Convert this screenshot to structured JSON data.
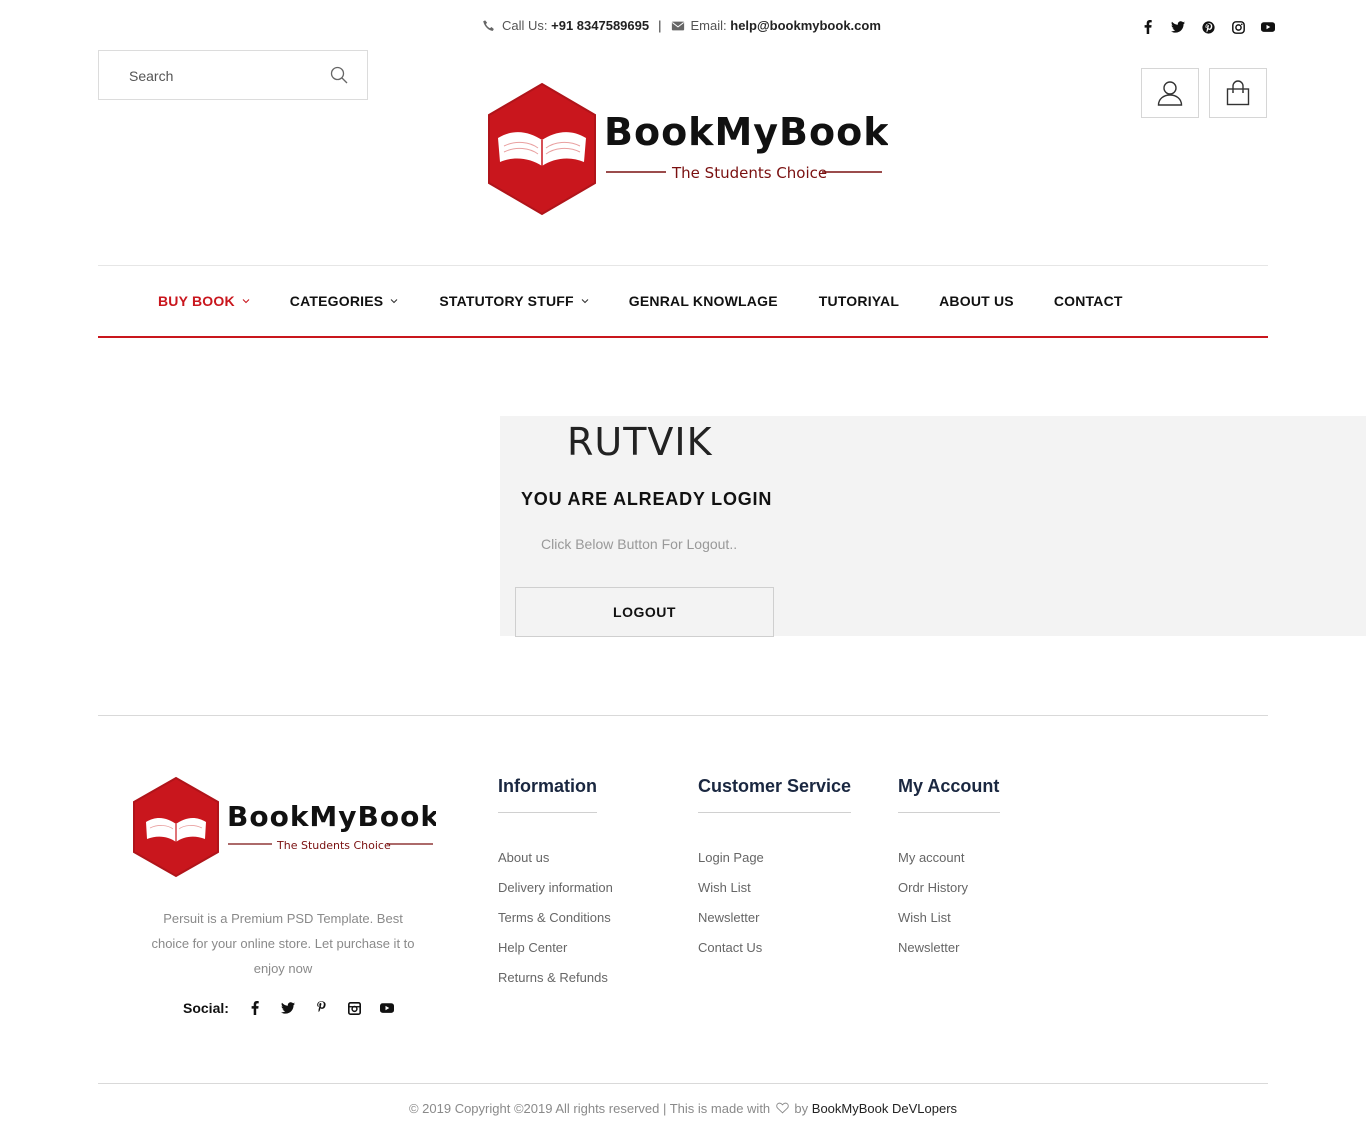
{
  "topbar": {
    "call_label": "Call Us:",
    "phone": "+91 8347589695",
    "separator": "|",
    "email_label": "Email:",
    "email": "help@bookmybook.com",
    "social_icons": [
      "facebook-icon",
      "twitter-icon",
      "pinterest-icon",
      "instagram-icon",
      "youtube-icon"
    ]
  },
  "search": {
    "placeholder": "Search"
  },
  "brand": {
    "name": "BookMyBook",
    "tagline": "The Students Choice",
    "color": "#c9161d"
  },
  "header_actions": [
    "user-icon",
    "shopping-bag-icon"
  ],
  "nav": {
    "items": [
      {
        "label": "BUY BOOK",
        "dropdown": true,
        "active": true
      },
      {
        "label": "CATEGORIES",
        "dropdown": true,
        "active": false
      },
      {
        "label": "STATUTORY STUFF",
        "dropdown": true,
        "active": false
      },
      {
        "label": "GENRAL KNOWLAGE",
        "dropdown": false,
        "active": false
      },
      {
        "label": "TUTORIYAL",
        "dropdown": false,
        "active": false
      },
      {
        "label": "ABOUT US",
        "dropdown": false,
        "active": false
      },
      {
        "label": "CONTACT",
        "dropdown": false,
        "active": false
      }
    ]
  },
  "account_panel": {
    "username": "RUTVIK",
    "status": "YOU ARE ALREADY LOGIN",
    "hint": "Click Below Button For Logout..",
    "logout_label": "LOGOUT"
  },
  "footer": {
    "description": "Persuit is a Premium PSD Template. Best choice for your online store. Let purchase it to enjoy now",
    "social_label": "Social:",
    "columns": [
      {
        "title": "Information",
        "links": [
          "About us",
          "Delivery information",
          "Terms & Conditions",
          "Help Center",
          "Returns & Refunds"
        ]
      },
      {
        "title": "Customer Service",
        "links": [
          "Login Page",
          "Wish List",
          "Newsletter",
          "Contact Us"
        ]
      },
      {
        "title": "My Account",
        "links": [
          "My account",
          "Ordr History",
          "Wish List",
          "Newsletter"
        ]
      }
    ],
    "copyright_prefix": "© 2019 Copyright ©2019 All rights reserved | This is made with",
    "copyright_by": "by",
    "copyright_brand": "BookMyBook DeVLopers"
  }
}
